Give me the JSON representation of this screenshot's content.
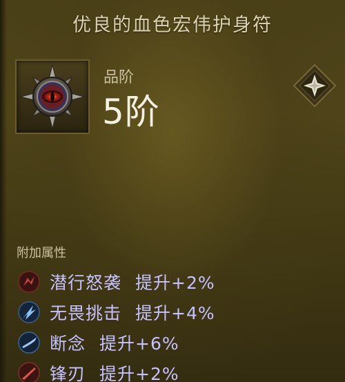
{
  "item": {
    "title": "优良的血色宏伟护身符",
    "rank_label": "品阶",
    "rank_value": "5阶"
  },
  "attributes": {
    "header": "附加属性",
    "rows": [
      {
        "name": "潜行怒袭",
        "effect": "提升+2%",
        "icon": "red-skill-icon",
        "color": "#b0403a"
      },
      {
        "name": "无畏挑击",
        "effect": "提升+4%",
        "icon": "blue-strike-icon",
        "color": "#3f6fa8"
      },
      {
        "name": "断念",
        "effect": "提升+6%",
        "icon": "blue-blade-icon",
        "color": "#3a73a0"
      },
      {
        "name": "锋刃",
        "effect": "提升+2%",
        "icon": "red-blade-icon",
        "color": "#b24438"
      }
    ]
  },
  "colors": {
    "attribute_text": "#c7c2ff",
    "title_text": "#ddd3b2",
    "panel_bg": "#4a4017"
  }
}
